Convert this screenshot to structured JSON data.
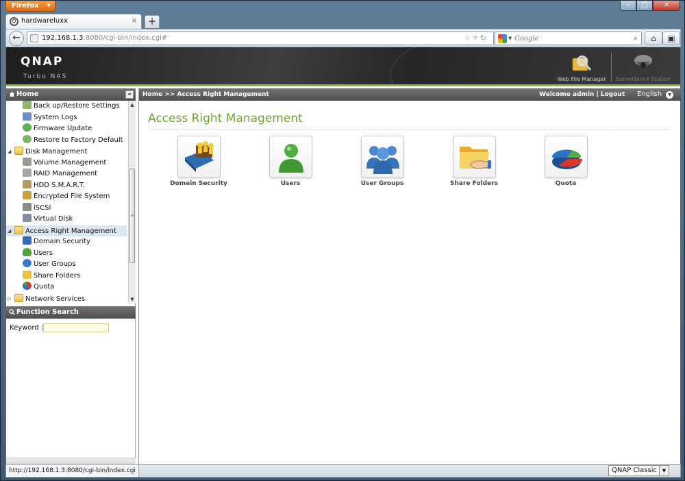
{
  "browser": {
    "app_button": "Firefox",
    "tab_title": "hardwareluxx",
    "tab_close": "×",
    "new_tab": "+",
    "url_host": "192.168.1.3",
    "url_rest": ":8080/cgi-bin/index.cgi#",
    "search_placeholder": "Google",
    "status_url": "http://192.168.1.3:8080/cgi-bin/index.cgi"
  },
  "header": {
    "logo": "QNAP",
    "subtitle": "Turbo NAS",
    "apps": [
      {
        "label": "Web File Manager",
        "icon": "magnifier-folder-icon"
      },
      {
        "label": "Surveillance Station",
        "icon": "camera-dome-icon"
      }
    ]
  },
  "left_panel": {
    "header": "Home",
    "collapse_glyph": "«",
    "tree": [
      {
        "label": "Back up/Restore Settings",
        "level": "child",
        "icon": "backup-icon"
      },
      {
        "label": "System Logs",
        "level": "child",
        "icon": "logs-icon"
      },
      {
        "label": "Firmware Update",
        "level": "child",
        "icon": "firmware-icon"
      },
      {
        "label": "Restore to Factory Default",
        "level": "child",
        "icon": "restore-icon"
      },
      {
        "label": "Disk Management",
        "level": "folder",
        "icon": "folder-icon"
      },
      {
        "label": "Volume Management",
        "level": "child",
        "icon": "volume-icon"
      },
      {
        "label": "RAID Management",
        "level": "child",
        "icon": "raid-icon"
      },
      {
        "label": "HDD S.M.A.R.T.",
        "level": "child",
        "icon": "hdd-icon"
      },
      {
        "label": "Encrypted File System",
        "level": "child",
        "icon": "lock-icon"
      },
      {
        "label": "iSCSI",
        "level": "child",
        "icon": "iscsi-icon"
      },
      {
        "label": "Virtual Disk",
        "level": "child",
        "icon": "virtual-disk-icon"
      },
      {
        "label": "Access Right Management",
        "level": "folder",
        "icon": "folder-icon",
        "selected": true
      },
      {
        "label": "Domain Security",
        "level": "child",
        "icon": "book-icon"
      },
      {
        "label": "Users",
        "level": "child",
        "icon": "user-icon"
      },
      {
        "label": "User Groups",
        "level": "child",
        "icon": "group-icon"
      },
      {
        "label": "Share Folders",
        "level": "child",
        "icon": "share-folder-icon"
      },
      {
        "label": "Quota",
        "level": "child",
        "icon": "quota-icon"
      },
      {
        "label": "Network Services",
        "level": "folder",
        "icon": "folder-icon",
        "collapsed": true
      }
    ],
    "function_search": {
      "header": "Function Search",
      "keyword_label": "Keyword :",
      "keyword_value": ""
    }
  },
  "main": {
    "breadcrumb": "Home >> Access Right Management",
    "welcome": "Welcome admin | Logout",
    "language": "English",
    "title": "Access Right Management",
    "tiles": [
      {
        "label": "Domain Security",
        "icon": "domain-security-icon"
      },
      {
        "label": "Users",
        "icon": "user-icon"
      },
      {
        "label": "User Groups",
        "icon": "user-groups-icon"
      },
      {
        "label": "Share Folders",
        "icon": "share-folders-icon"
      },
      {
        "label": "Quota",
        "icon": "quota-pie-icon"
      }
    ]
  },
  "footer": {
    "theme": "QNAP Classic"
  },
  "colors": {
    "accent_green": "#6aa52c",
    "header_dark": "#2e2e2e",
    "firefox_orange": "#e8841f"
  }
}
